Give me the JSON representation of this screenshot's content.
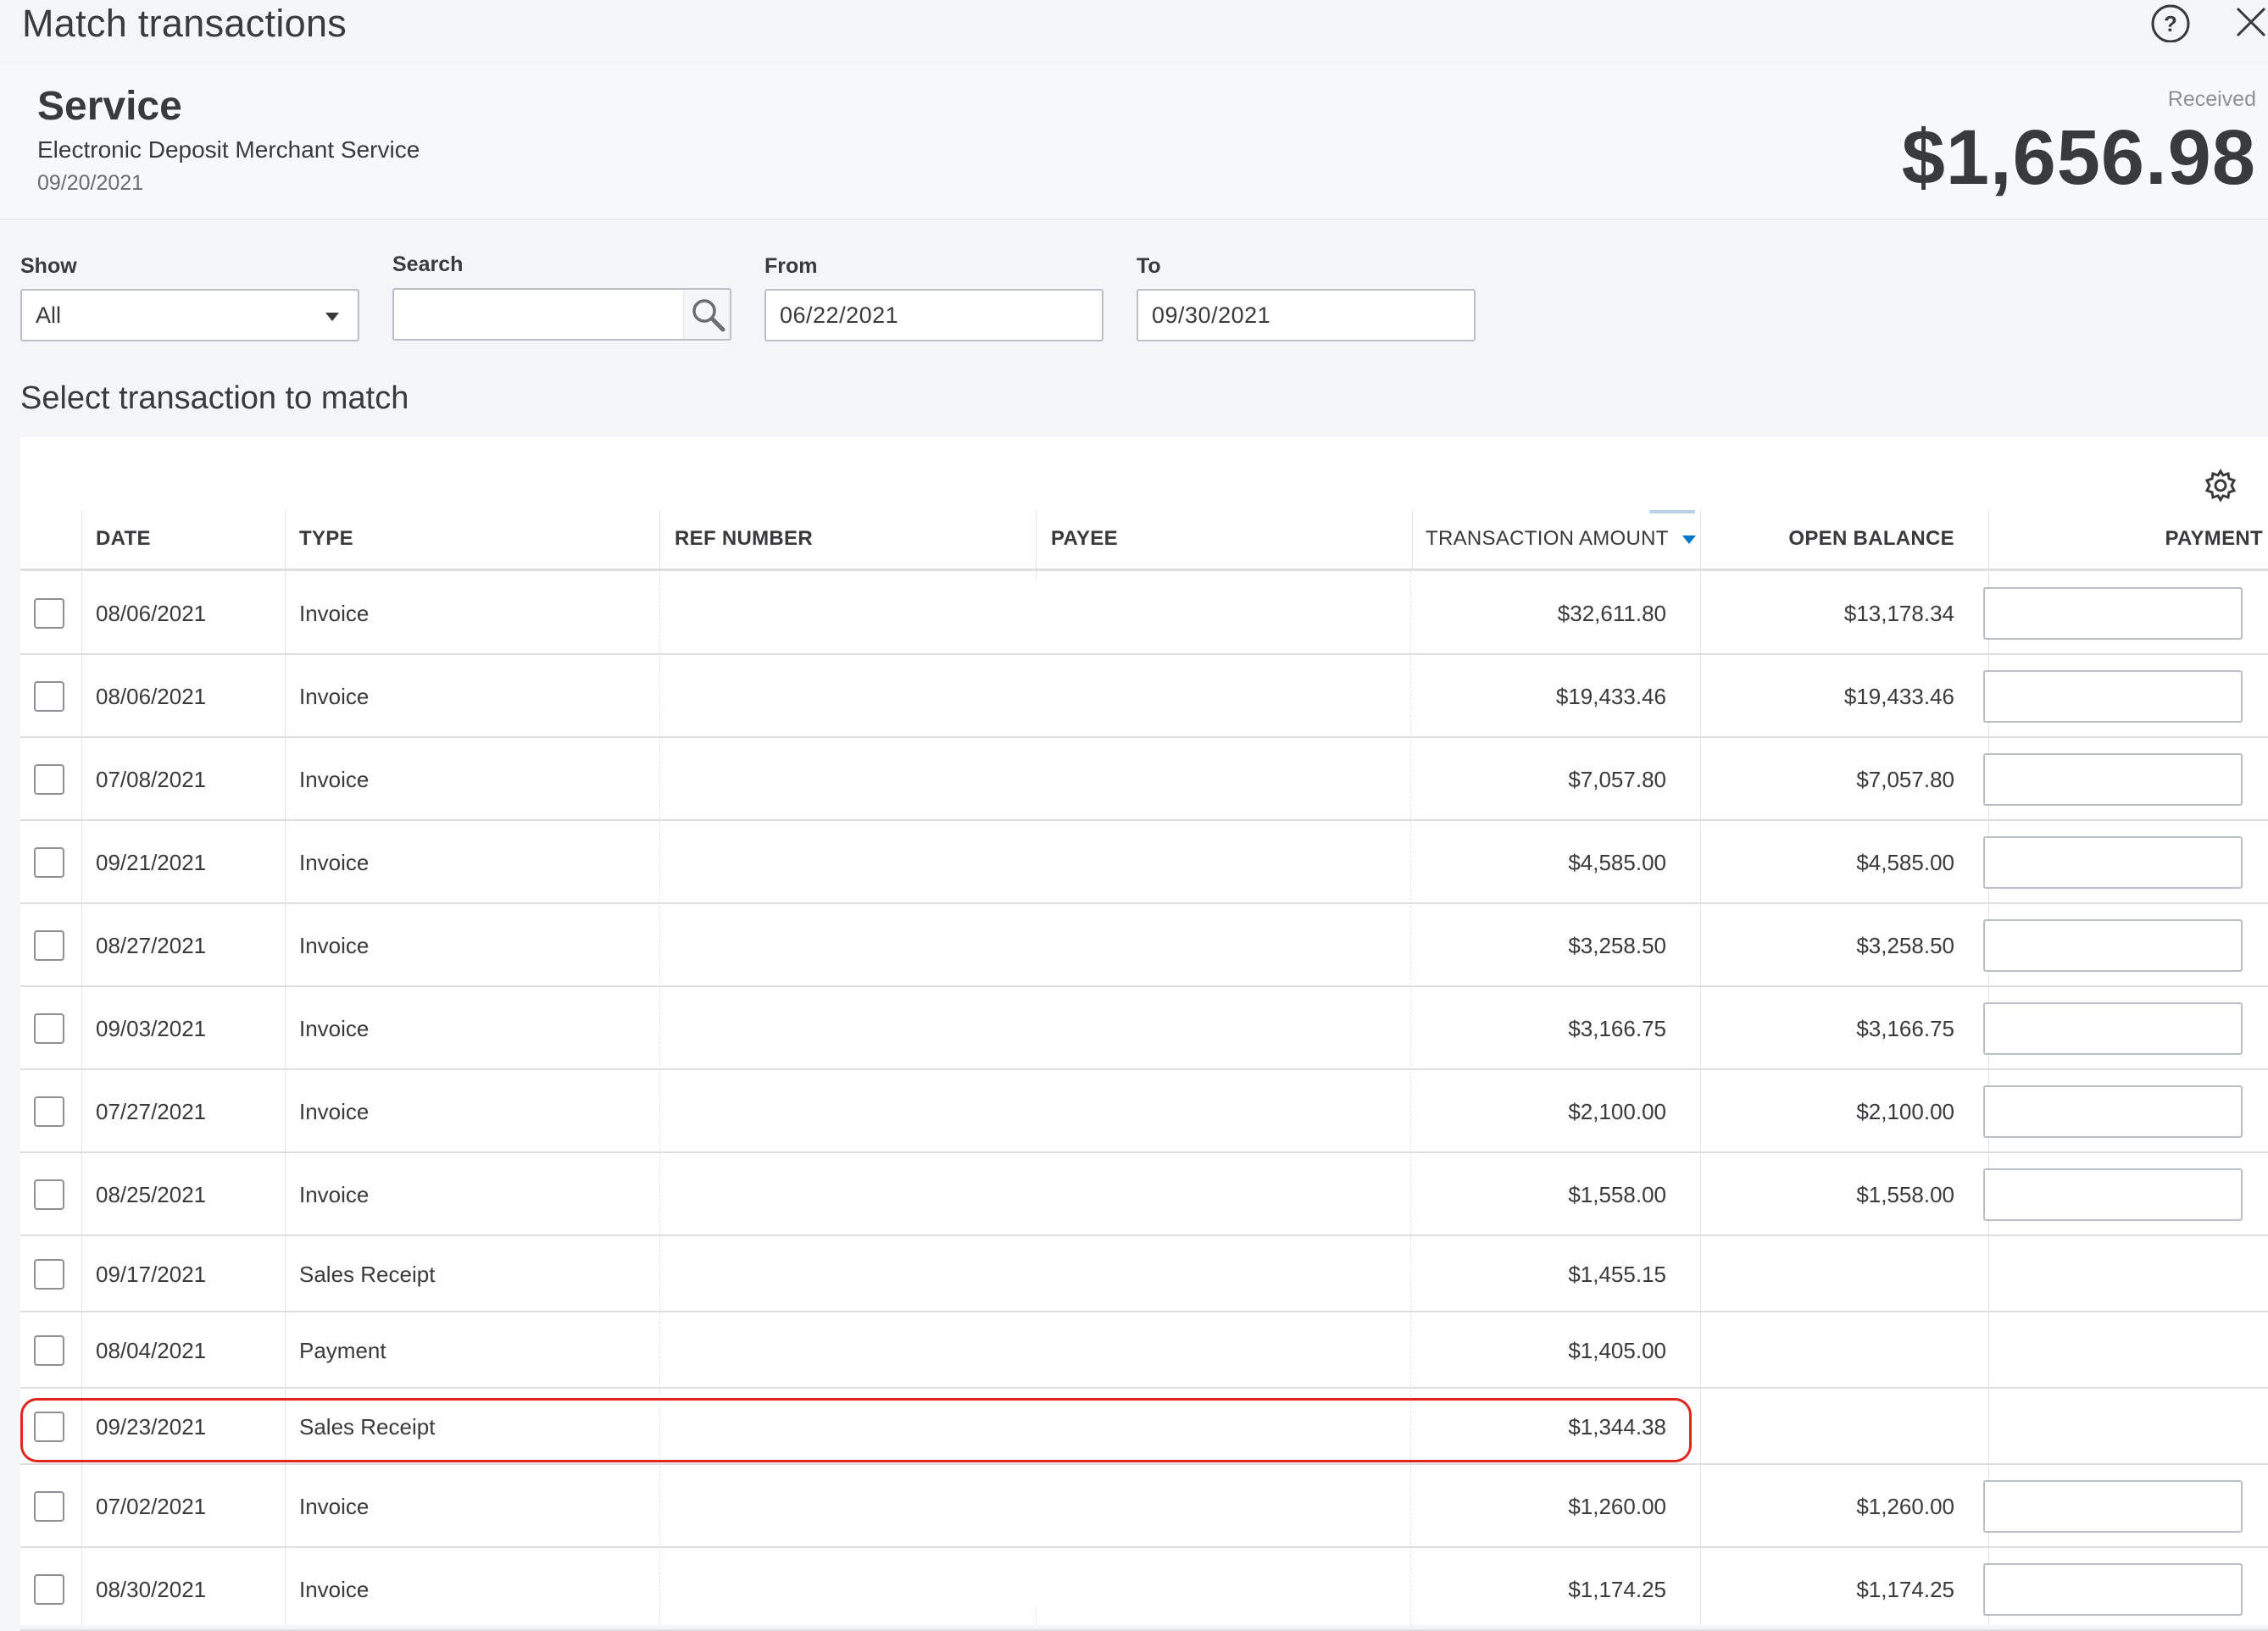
{
  "dialog": {
    "title": "Match transactions",
    "help_icon": "help-circle-icon",
    "close_icon": "close-icon"
  },
  "deposit": {
    "name": "Service",
    "description": "Electronic Deposit Merchant Service",
    "date": "09/20/2021",
    "received_label": "Received",
    "amount": "$1,656.98"
  },
  "filters": {
    "show_label": "Show",
    "show_value": "All",
    "search_label": "Search",
    "search_value": "",
    "from_label": "From",
    "from_value": "06/22/2021",
    "to_label": "To",
    "to_value": "09/30/2021"
  },
  "section_heading": "Select transaction to match",
  "table": {
    "columns": {
      "date": "DATE",
      "type": "TYPE",
      "ref_number": "REF NUMBER",
      "payee": "PAYEE",
      "transaction_amount": "TRANSACTION AMOUNT",
      "open_balance": "OPEN BALANCE",
      "payment": "PAYMENT"
    },
    "sort_column": "transaction_amount",
    "sort_direction": "descending",
    "highlight_color": "#e0251f",
    "rows": [
      {
        "date": "08/06/2021",
        "type": "Invoice",
        "ref": "",
        "payee": "",
        "amount": "$32,611.80",
        "open_balance": "$13,178.34",
        "has_payment": true
      },
      {
        "date": "08/06/2021",
        "type": "Invoice",
        "ref": "",
        "payee": "",
        "amount": "$19,433.46",
        "open_balance": "$19,433.46",
        "has_payment": true
      },
      {
        "date": "07/08/2021",
        "type": "Invoice",
        "ref": "",
        "payee": "",
        "amount": "$7,057.80",
        "open_balance": "$7,057.80",
        "has_payment": true
      },
      {
        "date": "09/21/2021",
        "type": "Invoice",
        "ref": "",
        "payee": "",
        "amount": "$4,585.00",
        "open_balance": "$4,585.00",
        "has_payment": true
      },
      {
        "date": "08/27/2021",
        "type": "Invoice",
        "ref": "",
        "payee": "",
        "amount": "$3,258.50",
        "open_balance": "$3,258.50",
        "has_payment": true
      },
      {
        "date": "09/03/2021",
        "type": "Invoice",
        "ref": "",
        "payee": "",
        "amount": "$3,166.75",
        "open_balance": "$3,166.75",
        "has_payment": true
      },
      {
        "date": "07/27/2021",
        "type": "Invoice",
        "ref": "",
        "payee": "",
        "amount": "$2,100.00",
        "open_balance": "$2,100.00",
        "has_payment": true
      },
      {
        "date": "08/25/2021",
        "type": "Invoice",
        "ref": "",
        "payee": "",
        "amount": "$1,558.00",
        "open_balance": "$1,558.00",
        "has_payment": true
      },
      {
        "date": "09/17/2021",
        "type": "Sales Receipt",
        "ref": "",
        "payee": "",
        "amount": "$1,455.15",
        "open_balance": "",
        "has_payment": false
      },
      {
        "date": "08/04/2021",
        "type": "Payment",
        "ref": "",
        "payee": "",
        "amount": "$1,405.00",
        "open_balance": "",
        "has_payment": false
      },
      {
        "date": "09/23/2021",
        "type": "Sales Receipt",
        "ref": "",
        "payee": "",
        "amount": "$1,344.38",
        "open_balance": "",
        "has_payment": false,
        "highlighted": true
      },
      {
        "date": "07/02/2021",
        "type": "Invoice",
        "ref": "",
        "payee": "",
        "amount": "$1,260.00",
        "open_balance": "$1,260.00",
        "has_payment": true
      },
      {
        "date": "08/30/2021",
        "type": "Invoice",
        "ref": "",
        "payee": "",
        "amount": "$1,174.25",
        "open_balance": "$1,174.25",
        "has_payment": true
      }
    ]
  },
  "icons": {
    "search": "search-icon",
    "settings": "gear-icon",
    "dropdown": "chevron-down-icon",
    "sort": "sort-descending-icon"
  }
}
